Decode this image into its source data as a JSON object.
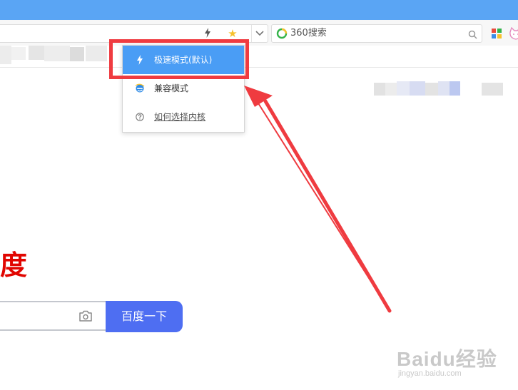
{
  "toolbar": {
    "search_engine": "360搜索"
  },
  "kernel_menu": {
    "items": [
      {
        "label": "极速模式(默认)",
        "icon": "lightning-icon",
        "active": true
      },
      {
        "label": "兼容模式",
        "icon": "ie-icon",
        "active": false
      },
      {
        "label": "如何选择内核",
        "icon": "help-circle-icon",
        "active": false
      }
    ]
  },
  "page": {
    "logo_text": "度",
    "search_button": "百度一下"
  },
  "watermark": {
    "main": "Baidu经验",
    "sub": "jingyan.baidu.com"
  },
  "colors": {
    "titlebar": "#5aa5f4",
    "menu_active": "#4a9df5",
    "highlight": "#ef3b40",
    "baidu_red": "#e10601",
    "baidu_button": "#4e6ef2"
  }
}
